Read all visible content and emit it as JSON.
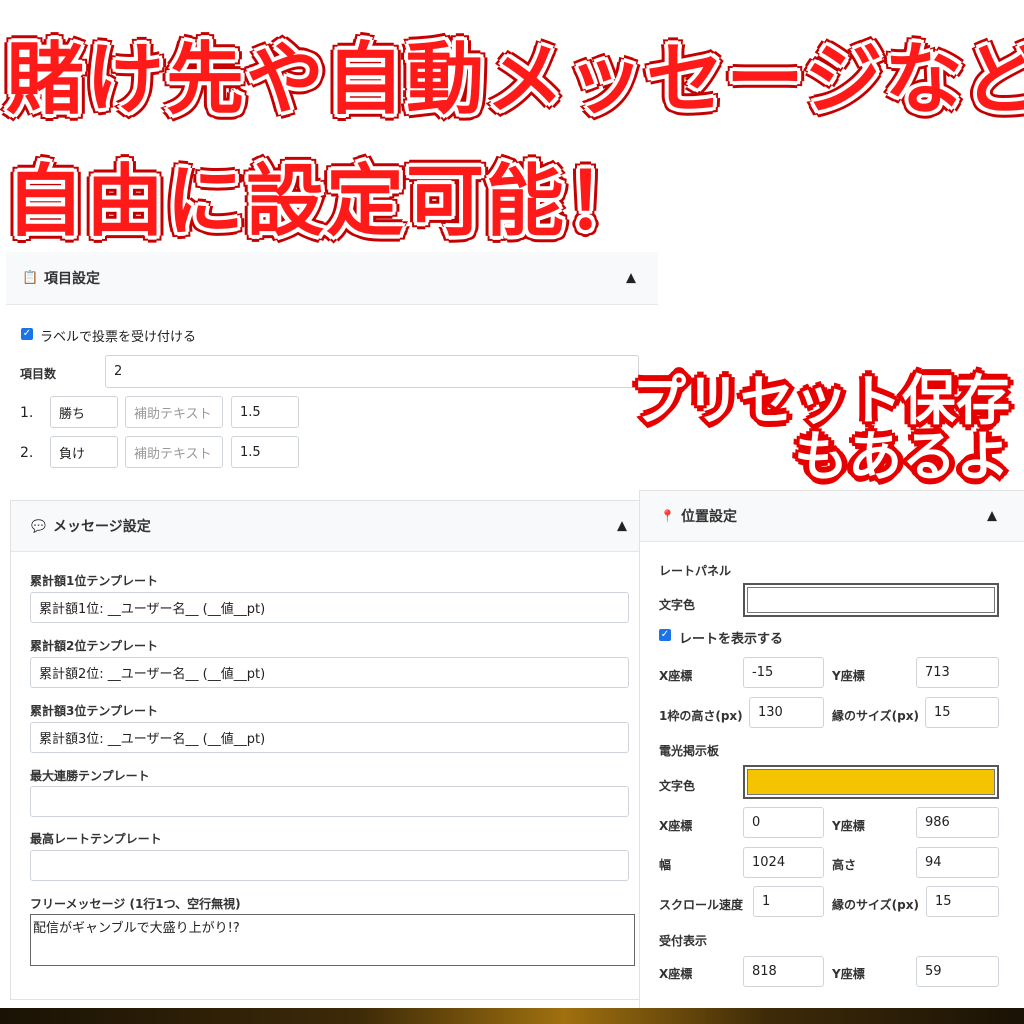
{
  "headline": {
    "line1": "賭け先や自動メッセージなど",
    "line2": "自由に設定可能！",
    "badge_line1": "プリセット保存",
    "badge_line2": "もあるよ"
  },
  "items_panel": {
    "title": "項目設定",
    "icon": "clipboard-icon",
    "label_vote_checkbox": "ラベルで投票を受け付ける",
    "label_vote_checked": true,
    "count_label": "項目数",
    "count_value": "2",
    "rows": [
      {
        "num": "1.",
        "name": "勝ち",
        "hint_placeholder": "補助テキスト",
        "odds": "1.5"
      },
      {
        "num": "2.",
        "name": "負け",
        "hint_placeholder": "補助テキスト",
        "odds": "1.5"
      }
    ]
  },
  "message_panel": {
    "title": "メッセージ設定",
    "icon": "speech-bubble-icon",
    "fields": [
      {
        "label": "累計額1位テンプレート",
        "value": "累計額1位: __ユーザー名__ (__値__pt)"
      },
      {
        "label": "累計額2位テンプレート",
        "value": "累計額2位: __ユーザー名__ (__値__pt)"
      },
      {
        "label": "累計額3位テンプレート",
        "value": "累計額3位: __ユーザー名__ (__値__pt)"
      },
      {
        "label": "最大連勝テンプレート",
        "value": ""
      },
      {
        "label": "最高レートテンプレート",
        "value": ""
      }
    ],
    "free_label": "フリーメッセージ (1行1つ、空行無視)",
    "free_value": "配信がギャンブルで大盛り上がり!?"
  },
  "position_panel": {
    "title": "位置設定",
    "icon": "pin-icon",
    "rate_section": "レートパネル",
    "text_color_label": "文字色",
    "rate_text_color": "#ffffff",
    "show_rate_label": "レートを表示する",
    "show_rate_checked": true,
    "x_label": "X座標",
    "y_label": "Y座標",
    "rate_x": "-15",
    "rate_y": "713",
    "row_height_label": "1枠の高さ(px)",
    "row_height": "130",
    "border_size_label": "縁のサイズ(px)",
    "rate_border": "15",
    "board_section": "電光掲示板",
    "board_text_color": "#f5c400",
    "board_x": "0",
    "board_y": "986",
    "width_label": "幅",
    "board_width": "1024",
    "height_label": "高さ",
    "board_height": "94",
    "scroll_label": "スクロール速度",
    "scroll_speed": "1",
    "board_border": "15",
    "accept_section": "受付表示",
    "accept_x": "818",
    "accept_y": "59"
  },
  "colors": {
    "headline_red": "#ff1a1a",
    "checkbox_blue": "#1a73e8"
  }
}
